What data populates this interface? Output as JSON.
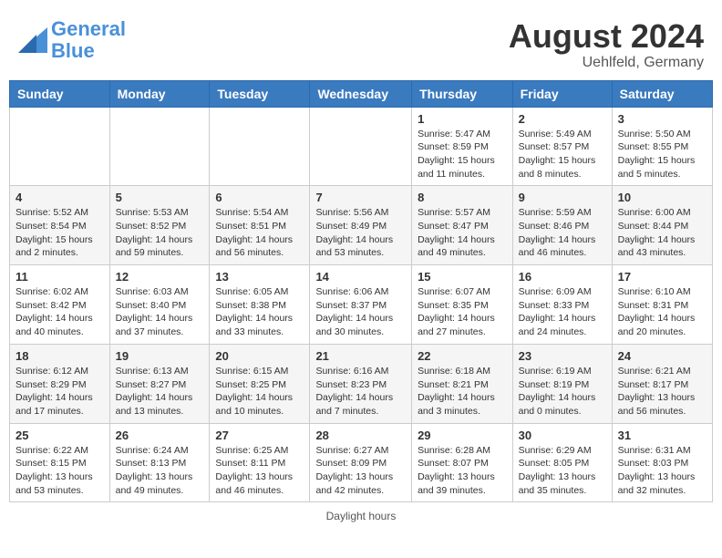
{
  "header": {
    "logo_line1": "General",
    "logo_line2": "Blue",
    "month": "August 2024",
    "location": "Uehlfeld, Germany"
  },
  "days_of_week": [
    "Sunday",
    "Monday",
    "Tuesday",
    "Wednesday",
    "Thursday",
    "Friday",
    "Saturday"
  ],
  "footer": "Daylight hours",
  "weeks": [
    [
      {
        "day": "",
        "info": ""
      },
      {
        "day": "",
        "info": ""
      },
      {
        "day": "",
        "info": ""
      },
      {
        "day": "",
        "info": ""
      },
      {
        "day": "1",
        "info": "Sunrise: 5:47 AM\nSunset: 8:59 PM\nDaylight: 15 hours\nand 11 minutes."
      },
      {
        "day": "2",
        "info": "Sunrise: 5:49 AM\nSunset: 8:57 PM\nDaylight: 15 hours\nand 8 minutes."
      },
      {
        "day": "3",
        "info": "Sunrise: 5:50 AM\nSunset: 8:55 PM\nDaylight: 15 hours\nand 5 minutes."
      }
    ],
    [
      {
        "day": "4",
        "info": "Sunrise: 5:52 AM\nSunset: 8:54 PM\nDaylight: 15 hours\nand 2 minutes."
      },
      {
        "day": "5",
        "info": "Sunrise: 5:53 AM\nSunset: 8:52 PM\nDaylight: 14 hours\nand 59 minutes."
      },
      {
        "day": "6",
        "info": "Sunrise: 5:54 AM\nSunset: 8:51 PM\nDaylight: 14 hours\nand 56 minutes."
      },
      {
        "day": "7",
        "info": "Sunrise: 5:56 AM\nSunset: 8:49 PM\nDaylight: 14 hours\nand 53 minutes."
      },
      {
        "day": "8",
        "info": "Sunrise: 5:57 AM\nSunset: 8:47 PM\nDaylight: 14 hours\nand 49 minutes."
      },
      {
        "day": "9",
        "info": "Sunrise: 5:59 AM\nSunset: 8:46 PM\nDaylight: 14 hours\nand 46 minutes."
      },
      {
        "day": "10",
        "info": "Sunrise: 6:00 AM\nSunset: 8:44 PM\nDaylight: 14 hours\nand 43 minutes."
      }
    ],
    [
      {
        "day": "11",
        "info": "Sunrise: 6:02 AM\nSunset: 8:42 PM\nDaylight: 14 hours\nand 40 minutes."
      },
      {
        "day": "12",
        "info": "Sunrise: 6:03 AM\nSunset: 8:40 PM\nDaylight: 14 hours\nand 37 minutes."
      },
      {
        "day": "13",
        "info": "Sunrise: 6:05 AM\nSunset: 8:38 PM\nDaylight: 14 hours\nand 33 minutes."
      },
      {
        "day": "14",
        "info": "Sunrise: 6:06 AM\nSunset: 8:37 PM\nDaylight: 14 hours\nand 30 minutes."
      },
      {
        "day": "15",
        "info": "Sunrise: 6:07 AM\nSunset: 8:35 PM\nDaylight: 14 hours\nand 27 minutes."
      },
      {
        "day": "16",
        "info": "Sunrise: 6:09 AM\nSunset: 8:33 PM\nDaylight: 14 hours\nand 24 minutes."
      },
      {
        "day": "17",
        "info": "Sunrise: 6:10 AM\nSunset: 8:31 PM\nDaylight: 14 hours\nand 20 minutes."
      }
    ],
    [
      {
        "day": "18",
        "info": "Sunrise: 6:12 AM\nSunset: 8:29 PM\nDaylight: 14 hours\nand 17 minutes."
      },
      {
        "day": "19",
        "info": "Sunrise: 6:13 AM\nSunset: 8:27 PM\nDaylight: 14 hours\nand 13 minutes."
      },
      {
        "day": "20",
        "info": "Sunrise: 6:15 AM\nSunset: 8:25 PM\nDaylight: 14 hours\nand 10 minutes."
      },
      {
        "day": "21",
        "info": "Sunrise: 6:16 AM\nSunset: 8:23 PM\nDaylight: 14 hours\nand 7 minutes."
      },
      {
        "day": "22",
        "info": "Sunrise: 6:18 AM\nSunset: 8:21 PM\nDaylight: 14 hours\nand 3 minutes."
      },
      {
        "day": "23",
        "info": "Sunrise: 6:19 AM\nSunset: 8:19 PM\nDaylight: 14 hours\nand 0 minutes."
      },
      {
        "day": "24",
        "info": "Sunrise: 6:21 AM\nSunset: 8:17 PM\nDaylight: 13 hours\nand 56 minutes."
      }
    ],
    [
      {
        "day": "25",
        "info": "Sunrise: 6:22 AM\nSunset: 8:15 PM\nDaylight: 13 hours\nand 53 minutes."
      },
      {
        "day": "26",
        "info": "Sunrise: 6:24 AM\nSunset: 8:13 PM\nDaylight: 13 hours\nand 49 minutes."
      },
      {
        "day": "27",
        "info": "Sunrise: 6:25 AM\nSunset: 8:11 PM\nDaylight: 13 hours\nand 46 minutes."
      },
      {
        "day": "28",
        "info": "Sunrise: 6:27 AM\nSunset: 8:09 PM\nDaylight: 13 hours\nand 42 minutes."
      },
      {
        "day": "29",
        "info": "Sunrise: 6:28 AM\nSunset: 8:07 PM\nDaylight: 13 hours\nand 39 minutes."
      },
      {
        "day": "30",
        "info": "Sunrise: 6:29 AM\nSunset: 8:05 PM\nDaylight: 13 hours\nand 35 minutes."
      },
      {
        "day": "31",
        "info": "Sunrise: 6:31 AM\nSunset: 8:03 PM\nDaylight: 13 hours\nand 32 minutes."
      }
    ]
  ]
}
